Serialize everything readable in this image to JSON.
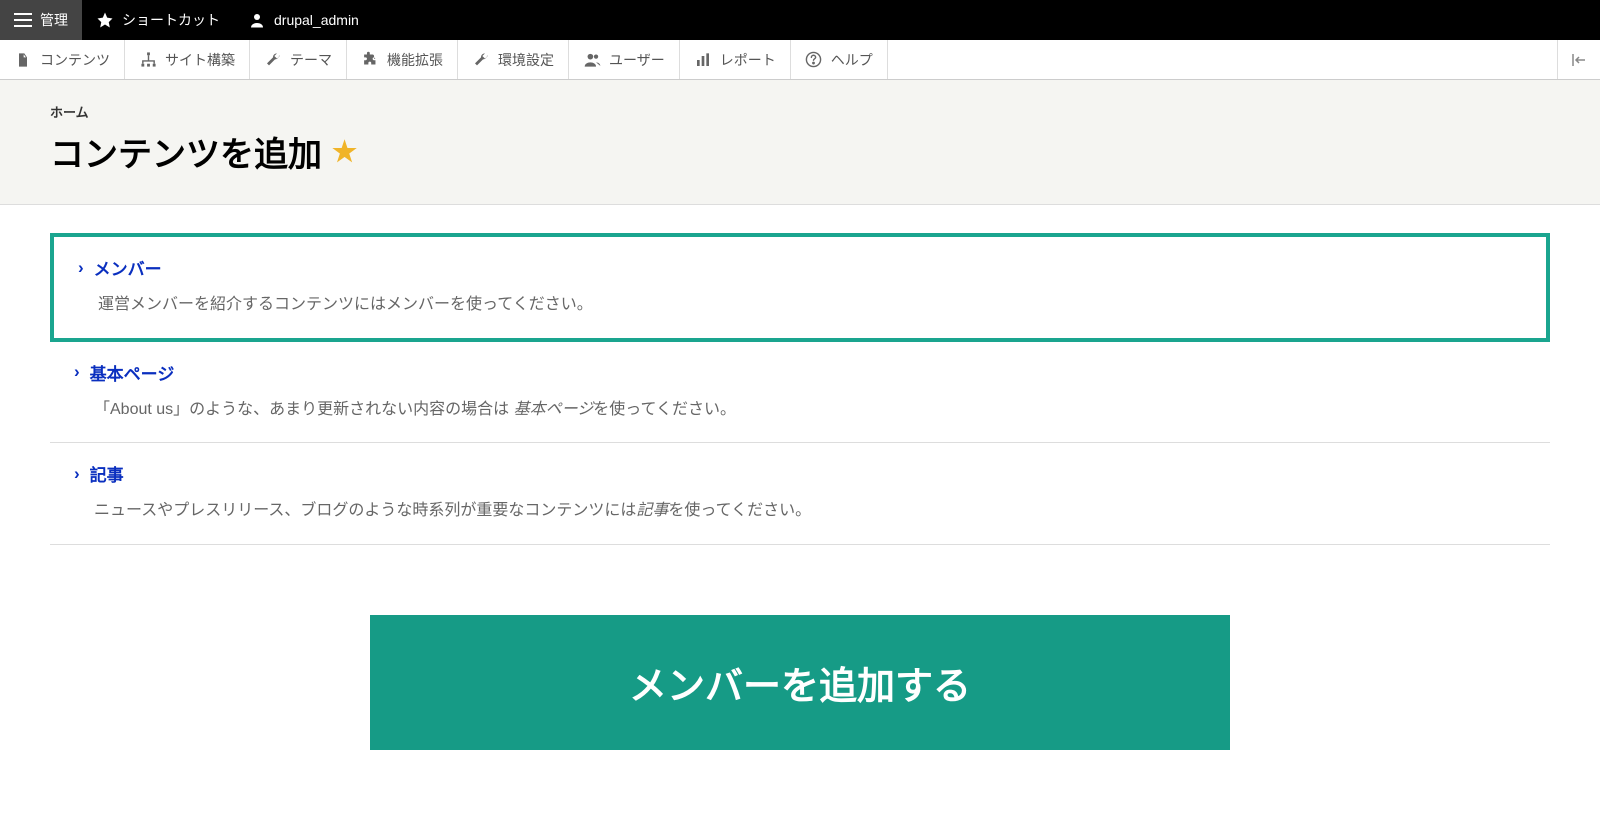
{
  "top_toolbar": {
    "admin_label": "管理",
    "shortcuts_label": "ショートカット",
    "username": "drupal_admin"
  },
  "admin_menu": {
    "items": [
      {
        "label": "コンテンツ",
        "icon": "file"
      },
      {
        "label": "サイト構築",
        "icon": "sitemap"
      },
      {
        "label": "テーマ",
        "icon": "wrench"
      },
      {
        "label": "機能拡張",
        "icon": "puzzle"
      },
      {
        "label": "環境設定",
        "icon": "wrench"
      },
      {
        "label": "ユーザー",
        "icon": "user"
      },
      {
        "label": "レポート",
        "icon": "chart"
      },
      {
        "label": "ヘルプ",
        "icon": "help"
      }
    ]
  },
  "header": {
    "breadcrumb": "ホーム",
    "title": "コンテンツを追加"
  },
  "content_types": [
    {
      "title": "メンバー",
      "desc_pre": "運営メンバーを紹介するコンテンツにはメンバーを使ってください。",
      "desc_emph": "",
      "desc_post": "",
      "highlighted": true
    },
    {
      "title": "基本ページ",
      "desc_pre": "「About us」のような、あまり更新されない内容の場合は ",
      "desc_emph": "基本ページ",
      "desc_post": "を使ってください。",
      "highlighted": false
    },
    {
      "title": "記事",
      "desc_pre": "ニュースやプレスリリース、ブログのような時系列が重要なコンテンツには",
      "desc_emph": "記事",
      "desc_post": "を使ってください。",
      "highlighted": false
    }
  ],
  "big_button": {
    "label": "メンバーを追加する"
  }
}
